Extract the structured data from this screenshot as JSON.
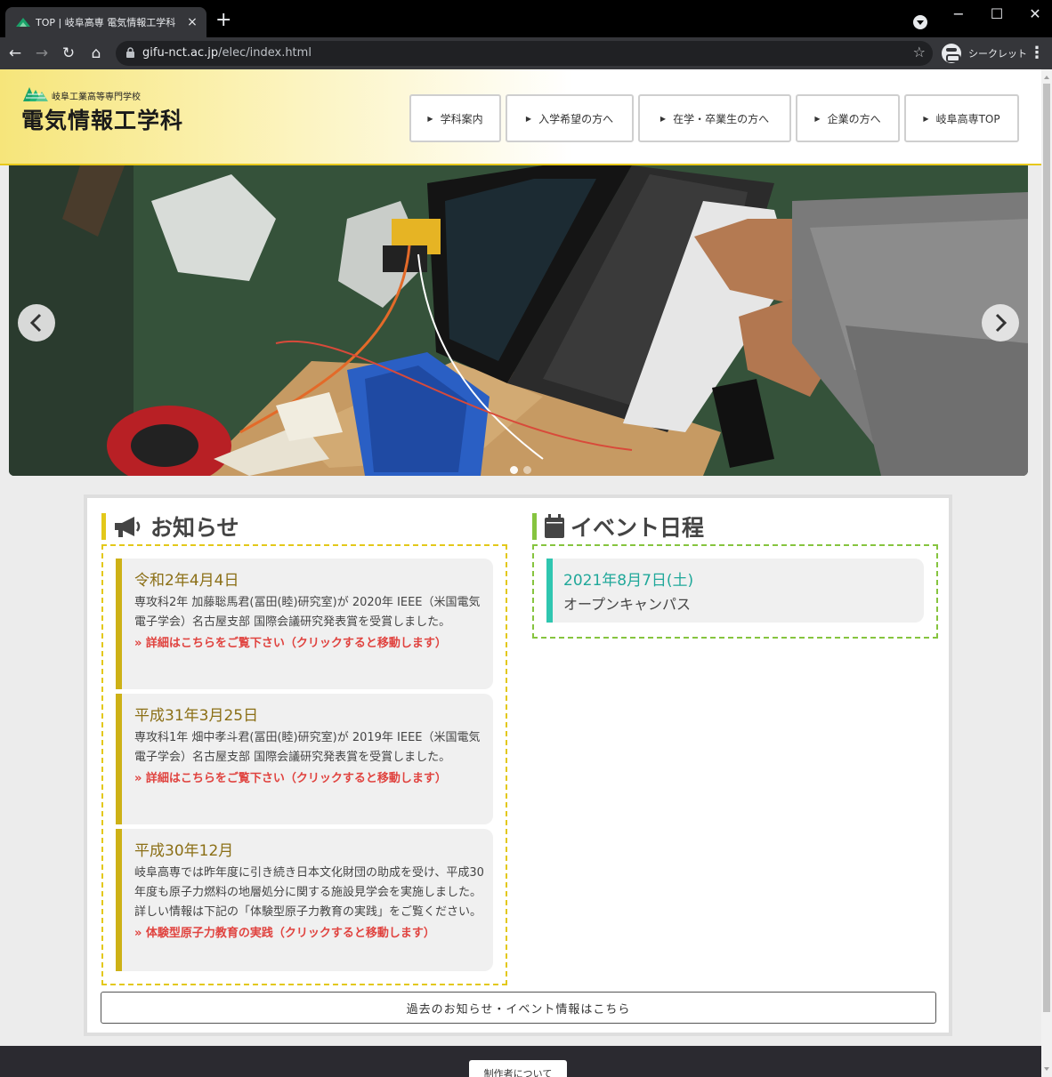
{
  "browser": {
    "tab_title": "TOP | 岐阜高専 電気情報工学科",
    "tab_close": "×",
    "new_tab": "+",
    "url_domain": "gifu-nct.ac.jp",
    "url_path": "/elec/index.html",
    "incognito_label": "シークレット",
    "window": {
      "minimize": "−",
      "maximize": "☐",
      "close": "✕"
    },
    "nav": {
      "back": "←",
      "forward": "→",
      "reload": "↻",
      "home": "⌂"
    },
    "star": "☆",
    "menu": "⋮",
    "colors": {
      "frame": "#000000",
      "toolbar": "#35363a",
      "omnibox": "#202124"
    }
  },
  "header": {
    "school_name": "岐阜工業高等専門学校",
    "dept_name": "電気情報工学科",
    "nav": [
      {
        "label": "学科案内"
      },
      {
        "label": "入学希望の方へ"
      },
      {
        "label": "在学・卒業生の方へ"
      },
      {
        "label": "企業の方へ"
      },
      {
        "label": "岐阜高専TOP"
      }
    ],
    "colors": {
      "gradient_start": "#f6e57a",
      "border": "#e7c81a",
      "logo": "#1aa36a"
    }
  },
  "slider": {
    "dots": [
      {
        "state": "active"
      },
      {
        "state": "inactive"
      }
    ]
  },
  "news": {
    "heading": "お知らせ",
    "items": [
      {
        "date": "令和2年4月4日",
        "body": "専攻科2年 加藤聡馬君(冨田(睦)研究室)が 2020年 IEEE（米国電気電子学会）名古屋支部 国際会議研究発表賞を受賞しました。",
        "link": "» 詳細はこちらをご覧下さい（クリックすると移動します）"
      },
      {
        "date": "平成31年3月25日",
        "body": "専攻科1年 畑中孝斗君(冨田(睦)研究室)が 2019年 IEEE（米国電気電子学会）名古屋支部 国際会議研究発表賞を受賞しました。",
        "link": "» 詳細はこちらをご覧下さい（クリックすると移動します）"
      },
      {
        "date": "平成30年12月",
        "body": "岐阜高専では昨年度に引き続き日本文化財団の助成を受け、平成30年度も原子力燃料の地層処分に関する施設見学会を実施しました。詳しい情報は下記の「体験型原子力教育の実践」をご覧ください。",
        "link": "» 体験型原子力教育の実践（クリックすると移動します）"
      }
    ],
    "colors": {
      "accent": "#cdb116",
      "date": "#8b6f16",
      "link": "#e0433f"
    }
  },
  "events": {
    "heading": "イベント日程",
    "items": [
      {
        "date": "2021年8月7日(土)",
        "title": "オープンキャンパス"
      }
    ],
    "colors": {
      "accent": "#2fc6b0",
      "frame": "#86c43f"
    }
  },
  "archive_button": "過去のお知らせ・イベント情報はこちら",
  "footer": {
    "about_button": "制作者について"
  },
  "icons": {
    "news": "megaphone-icon",
    "events": "calendar-icon",
    "slider_prev": "chevron-left-icon",
    "slider_next": "chevron-right-icon"
  }
}
